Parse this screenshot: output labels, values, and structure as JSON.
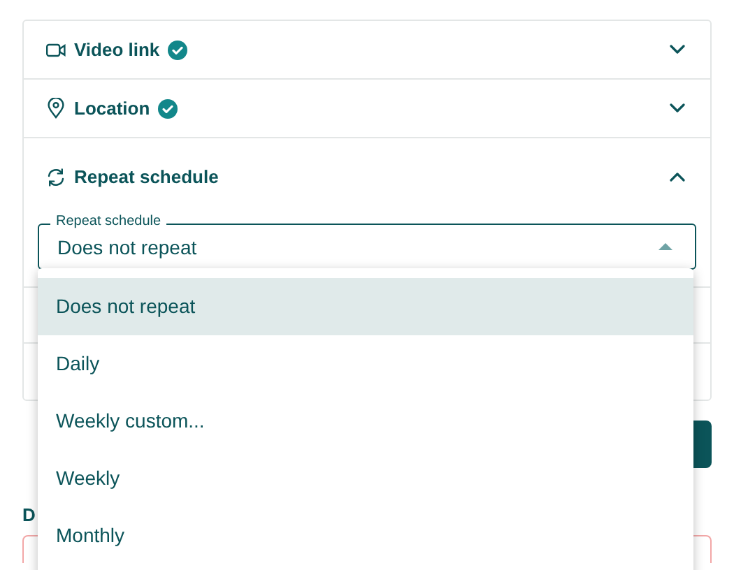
{
  "sections": [
    {
      "kind": "collapsed",
      "title": "Video link",
      "complete": true,
      "expanded": false
    },
    {
      "kind": "collapsed",
      "title": "Location",
      "complete": true,
      "expanded": false
    },
    {
      "kind": "expanded",
      "title": "Repeat schedule",
      "complete": false,
      "expanded": true
    }
  ],
  "repeat_select": {
    "label": "Repeat schedule",
    "value": "Does not repeat",
    "open": true
  },
  "repeat_options": [
    {
      "label": "Does not repeat",
      "selected": true
    },
    {
      "label": "Daily",
      "selected": false
    },
    {
      "label": "Weekly custom...",
      "selected": false
    },
    {
      "label": "Weekly",
      "selected": false
    },
    {
      "label": "Monthly",
      "selected": false
    }
  ],
  "date_label": "D",
  "date_field": {
    "invalid": true
  }
}
